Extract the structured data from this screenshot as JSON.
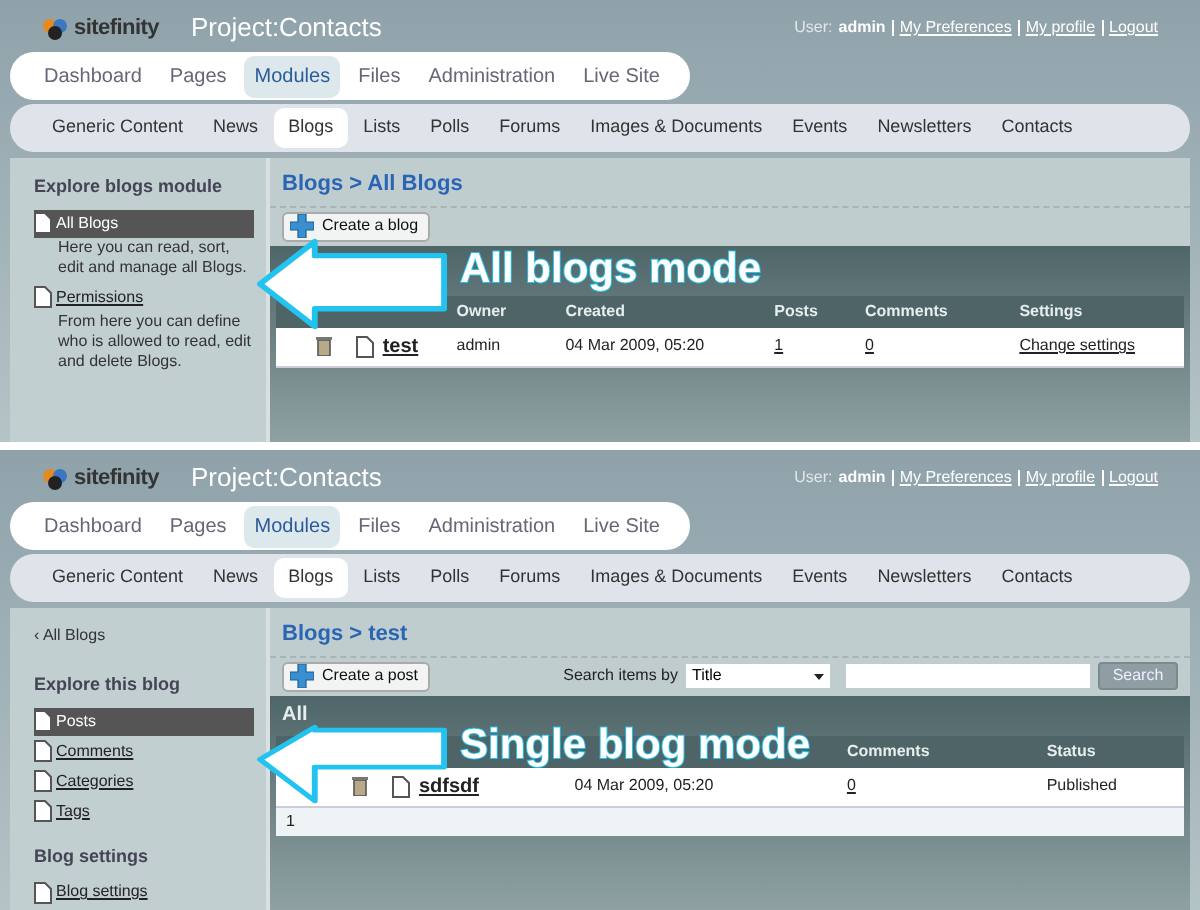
{
  "panels": [
    {
      "logo": "sitefinity",
      "project": "Project:Contacts",
      "user_label": "User:",
      "user_name": "admin",
      "user_links": [
        "My Preferences",
        "My profile",
        "Logout"
      ],
      "main_tabs": [
        {
          "label": "Dashboard",
          "selected": false
        },
        {
          "label": "Pages",
          "selected": false
        },
        {
          "label": "Modules",
          "selected": true
        },
        {
          "label": "Files",
          "selected": false
        },
        {
          "label": "Administration",
          "selected": false
        },
        {
          "label": "Live Site",
          "selected": false
        }
      ],
      "sub_tabs": [
        {
          "label": "Generic Content",
          "selected": false
        },
        {
          "label": "News",
          "selected": false
        },
        {
          "label": "Blogs",
          "selected": true
        },
        {
          "label": "Lists",
          "selected": false
        },
        {
          "label": "Polls",
          "selected": false
        },
        {
          "label": "Forums",
          "selected": false
        },
        {
          "label": "Images & Documents",
          "selected": false
        },
        {
          "label": "Events",
          "selected": false
        },
        {
          "label": "Newsletters",
          "selected": false
        },
        {
          "label": "Contacts",
          "selected": false
        }
      ],
      "sidebar": {
        "sections": [
          {
            "heading": "Explore blogs module",
            "items": [
              {
                "label": "All Blogs",
                "description": "Here you can read, sort, edit and manage all Blogs.",
                "selected": true
              },
              {
                "label": "Permissions",
                "description": "From here you can define who is allowed to read, edit and delete Blogs.",
                "selected": false
              }
            ]
          }
        ]
      },
      "breadcrumb": "Blogs > All Blogs",
      "toolbar": {
        "create_button": "Create a blog"
      },
      "grid": {
        "columns": [
          "",
          "",
          "Owner",
          "Created",
          "Posts",
          "Comments",
          "Settings"
        ],
        "rows": [
          {
            "cells": [
              {
                "kind": "trash"
              },
              {
                "kind": "doc-link",
                "text": "test"
              },
              {
                "kind": "text",
                "text": "admin"
              },
              {
                "kind": "text",
                "text": "04 Mar 2009, 05:20"
              },
              {
                "kind": "link",
                "text": "1"
              },
              {
                "kind": "link",
                "text": "0"
              },
              {
                "kind": "link",
                "text": "Change settings"
              }
            ]
          }
        ]
      },
      "annotation": "All blogs mode"
    },
    {
      "logo": "sitefinity",
      "project": "Project:Contacts",
      "user_label": "User:",
      "user_name": "admin",
      "user_links": [
        "My Preferences",
        "My profile",
        "Logout"
      ],
      "main_tabs": [
        {
          "label": "Dashboard",
          "selected": false
        },
        {
          "label": "Pages",
          "selected": false
        },
        {
          "label": "Modules",
          "selected": true
        },
        {
          "label": "Files",
          "selected": false
        },
        {
          "label": "Administration",
          "selected": false
        },
        {
          "label": "Live Site",
          "selected": false
        }
      ],
      "sub_tabs": [
        {
          "label": "Generic Content",
          "selected": false
        },
        {
          "label": "News",
          "selected": false
        },
        {
          "label": "Blogs",
          "selected": true
        },
        {
          "label": "Lists",
          "selected": false
        },
        {
          "label": "Polls",
          "selected": false
        },
        {
          "label": "Forums",
          "selected": false
        },
        {
          "label": "Images & Documents",
          "selected": false
        },
        {
          "label": "Events",
          "selected": false
        },
        {
          "label": "Newsletters",
          "selected": false
        },
        {
          "label": "Contacts",
          "selected": false
        }
      ],
      "sidebar": {
        "back_link": "‹ All Blogs",
        "sections": [
          {
            "heading": "Explore this blog",
            "items": [
              {
                "label": "Posts",
                "selected": true
              },
              {
                "label": "Comments",
                "selected": false
              },
              {
                "label": "Categories",
                "selected": false
              },
              {
                "label": "Tags",
                "selected": false
              }
            ]
          },
          {
            "heading": "Blog settings",
            "items": [
              {
                "label": "Blog settings",
                "selected": false
              }
            ]
          }
        ]
      },
      "breadcrumb": "Blogs > test",
      "toolbar": {
        "create_button": "Create a post",
        "search": {
          "label": "Search items by",
          "select_value": "Title",
          "button": "Search"
        }
      },
      "grid": {
        "title": "All",
        "columns": [
          "",
          "",
          "",
          "Comments",
          "Status"
        ],
        "rows": [
          {
            "cells": [
              {
                "kind": "trash"
              },
              {
                "kind": "doc-link",
                "text": "sdfsdf"
              },
              {
                "kind": "text",
                "text": "04 Mar 2009, 05:20"
              },
              {
                "kind": "link",
                "text": "0"
              },
              {
                "kind": "text",
                "text": "Published"
              }
            ]
          }
        ],
        "pager": "1"
      },
      "annotation": "Single blog mode"
    }
  ]
}
